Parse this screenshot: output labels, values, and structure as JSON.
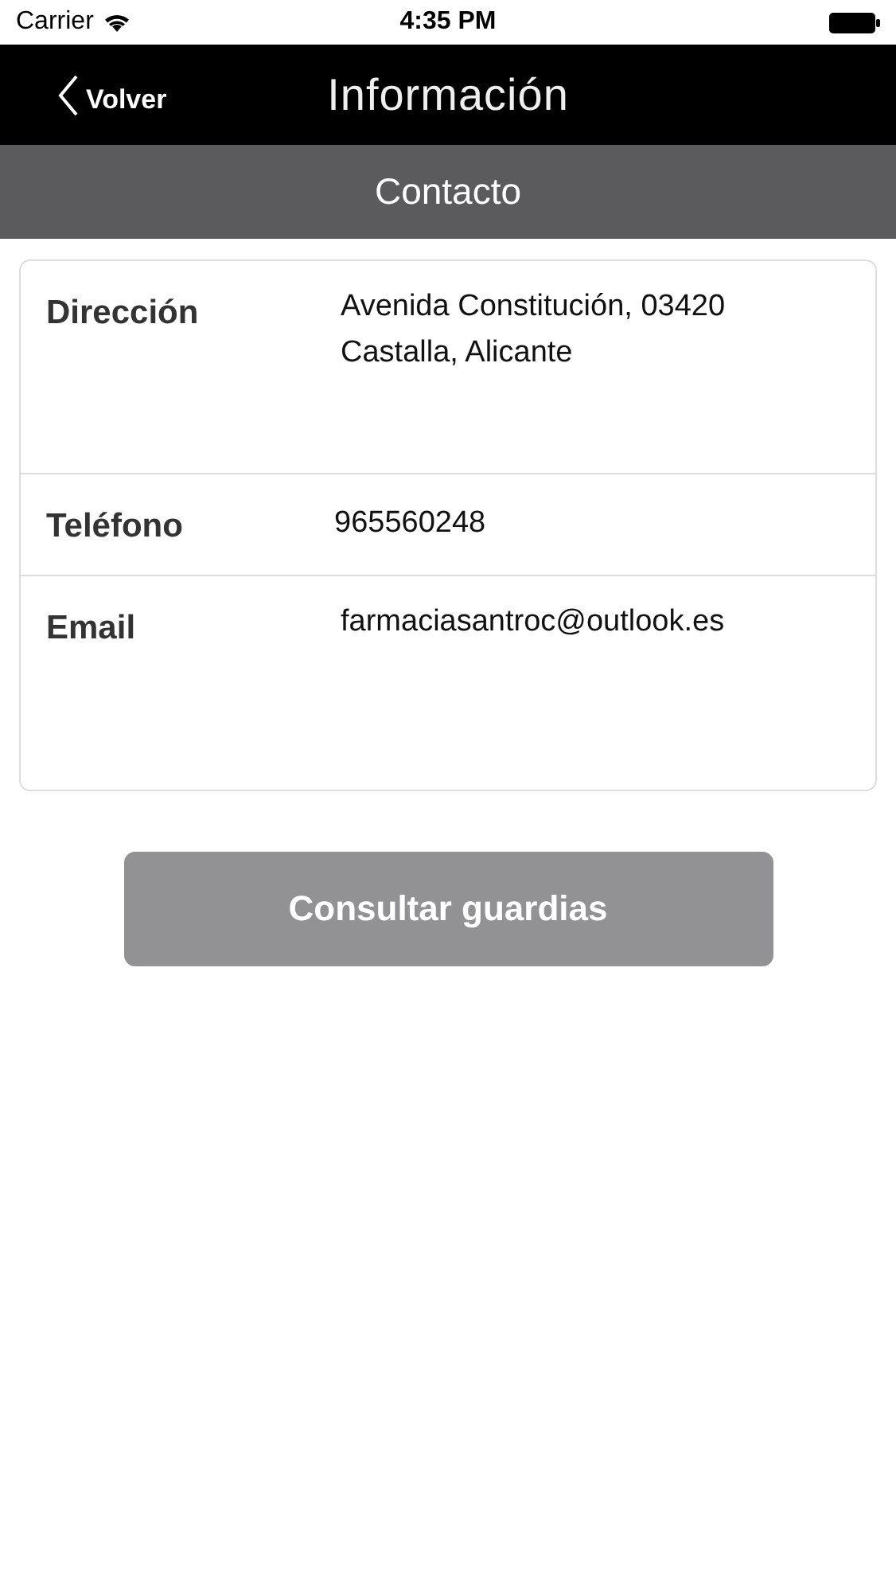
{
  "status_bar": {
    "carrier": "Carrier",
    "time": "4:35 PM"
  },
  "nav_bar": {
    "back": "Volver",
    "title": "Información"
  },
  "section_header": "Contacto",
  "contact_rows": [
    {
      "label": "Dirección",
      "lines": [
        "Avenida Constitución, 03420",
        "Castalla, Alicante"
      ]
    },
    {
      "label": "Teléfono",
      "lines": [
        "965560248"
      ]
    },
    {
      "label": "Email",
      "lines": [
        "farmaciasantroc@outlook.es"
      ]
    }
  ],
  "button": {
    "label": "Consultar guardias"
  }
}
